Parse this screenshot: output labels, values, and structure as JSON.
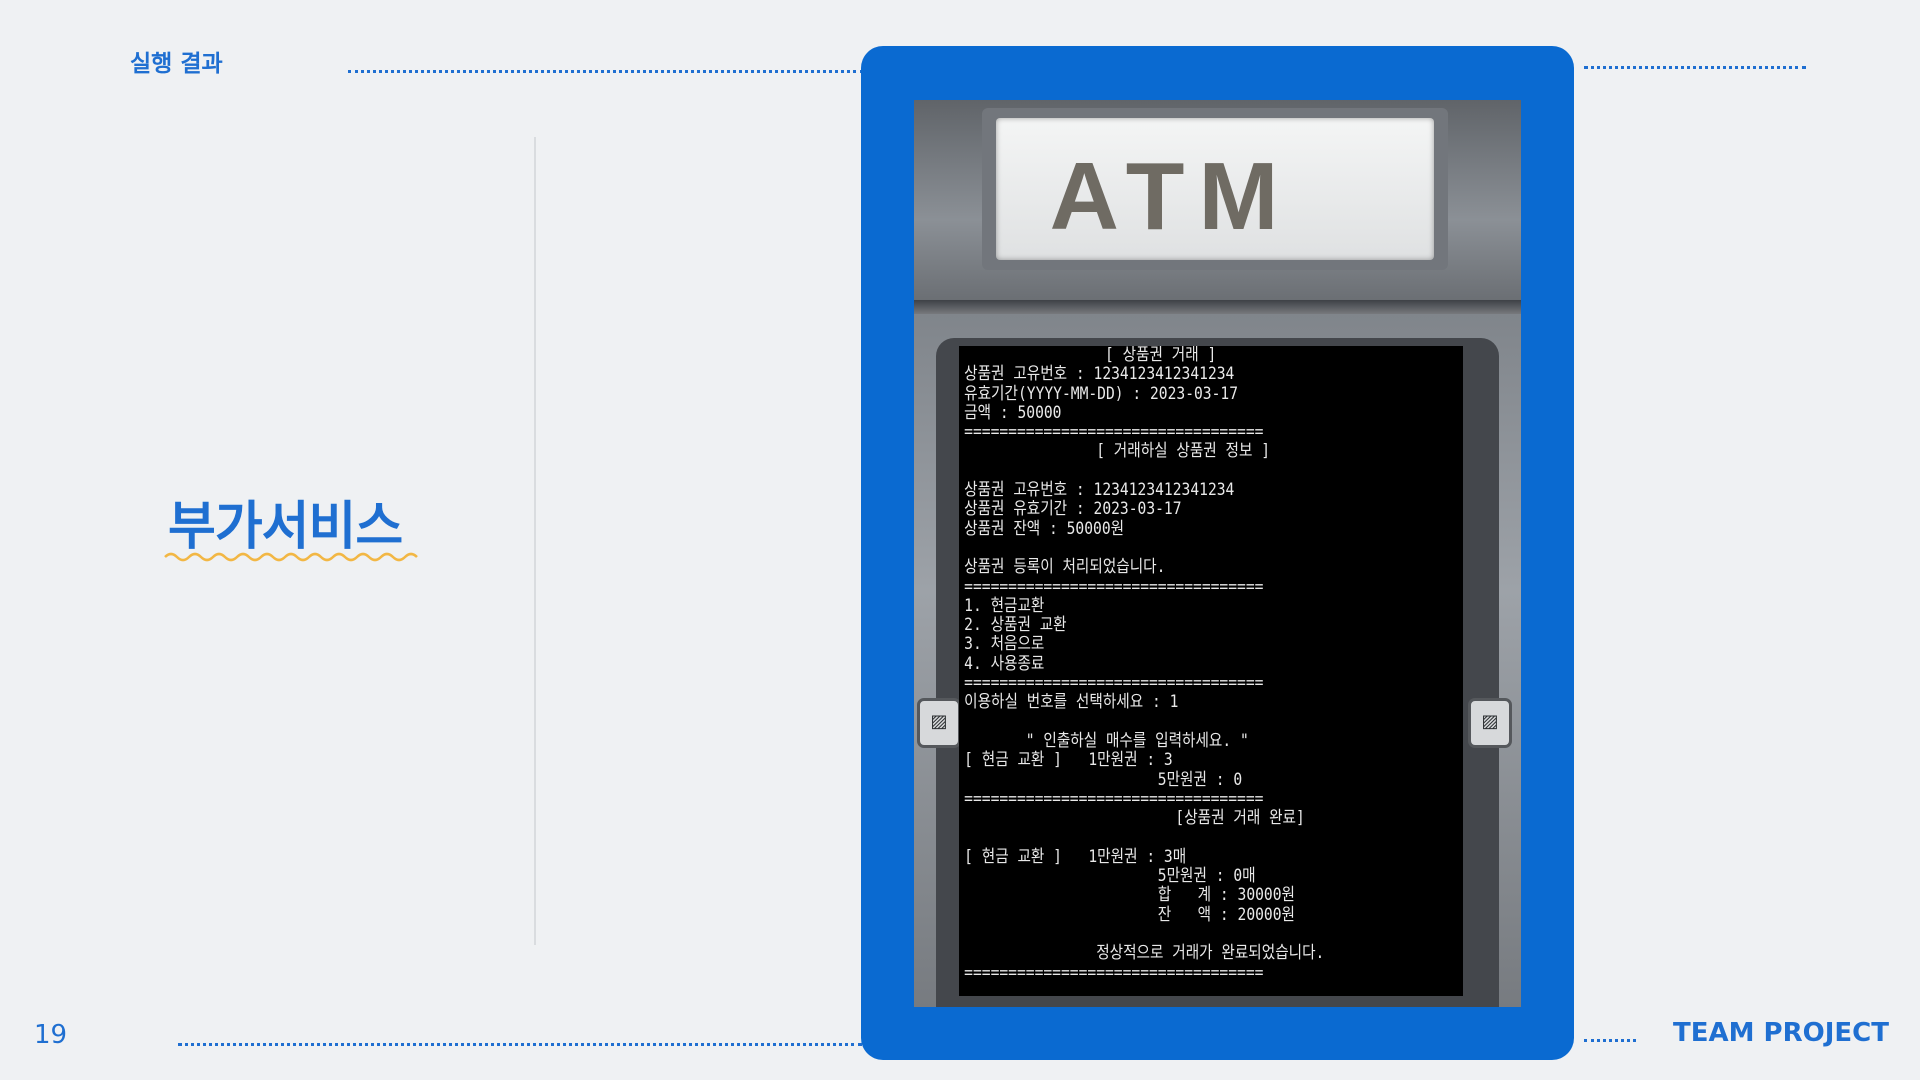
{
  "slide": {
    "section_label": "실행 결과",
    "title": "부가서비스",
    "page_number": "19",
    "footer_brand": "TEAM PROJECT",
    "accent_color": "#1f6fd1",
    "card_color": "#0a6ad1",
    "squiggle_color": "#f2b744"
  },
  "atm": {
    "sign": "ATM",
    "side_buttons": [
      "card-slot-icon",
      "card-slot-icon"
    ]
  },
  "console": {
    "lines": [
      "                [ 상품권 거래 ]",
      "상품권 고유번호 : 1234123412341234",
      "유효기간(YYYY-MM-DD) : 2023-03-17",
      "금액 : 50000",
      "==================================",
      "               [ 거래하실 상품권 정보 ]",
      "",
      "상품권 고유번호 : 1234123412341234",
      "상품권 유효기간 : 2023-03-17",
      "상품권 잔액 : 50000원",
      "",
      "상품권 등록이 처리되었습니다.",
      "==================================",
      "1. 현금교환",
      "2. 상품권 교환",
      "3. 처음으로",
      "4. 사용종료",
      "==================================",
      "이용하실 번호를 선택하세요 : 1",
      "",
      "       \" 인출하실 매수를 입력하세요. \"",
      "[ 현금 교환 ]   1만원권 : 3",
      "                      5만원권 : 0",
      "==================================",
      "                        [상품권 거래 완료]",
      "",
      "[ 현금 교환 ]   1만원권 : 3매",
      "                      5만원권 : 0매",
      "                      합   계 : 30000원",
      "                      잔   액 : 20000원",
      "",
      "               정상적으로 거래가 완료되었습니다.",
      "=================================="
    ]
  }
}
